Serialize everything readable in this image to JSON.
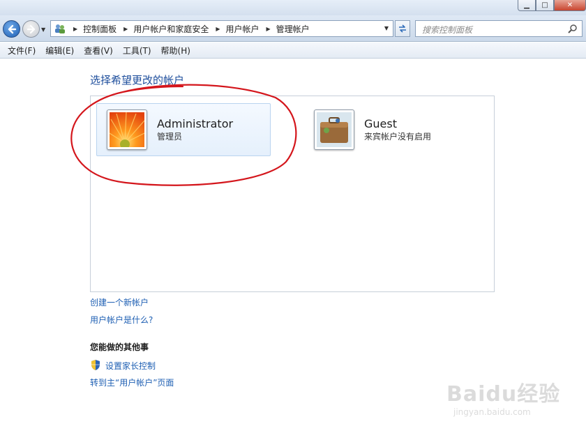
{
  "window": {
    "minimize": "▁",
    "maximize": "□",
    "close": "✕"
  },
  "nav": {
    "breadcrumbs": [
      "控制面板",
      "用户帐户和家庭安全",
      "用户帐户",
      "管理帐户"
    ],
    "search_placeholder": "搜索控制面板"
  },
  "menu": [
    "文件(F)",
    "编辑(E)",
    "查看(V)",
    "工具(T)",
    "帮助(H)"
  ],
  "main": {
    "heading": "选择希望更改的帐户",
    "accounts": [
      {
        "name": "Administrator",
        "type": "管理员",
        "icon": "flower-avatar-icon",
        "selected": true
      },
      {
        "name": "Guest",
        "type": "来宾帐户没有启用",
        "icon": "suitcase-avatar-icon",
        "selected": false
      }
    ],
    "links": {
      "create_account": "创建一个新帐户",
      "what_is_account": "用户帐户是什么?"
    },
    "other_section": {
      "title": "您能做的其他事",
      "parental_controls": "设置家长控制",
      "go_main_page": "转到主“用户帐户”页面"
    }
  },
  "annotation": {
    "color": "#d4161c"
  },
  "watermark": {
    "logo": "Baidu经验",
    "url": "jingyan.baidu.com"
  }
}
